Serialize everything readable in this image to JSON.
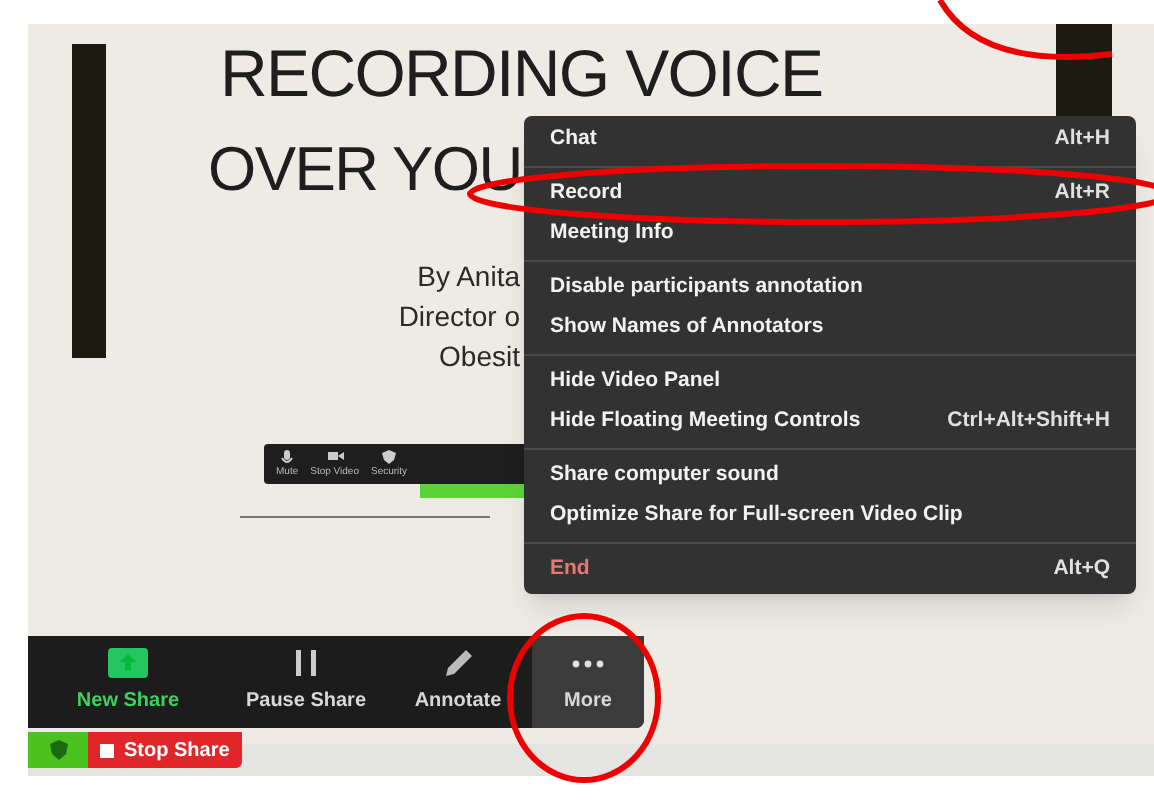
{
  "slide": {
    "title_lines": [
      "RECORDING VOICE",
      "OVER YOU"
    ],
    "byline_lines": [
      "By Anita",
      "Director o",
      "Obesit"
    ],
    "mini_toolbar": [
      {
        "label": "Mute",
        "kind": "mic"
      },
      {
        "label": "Stop Video",
        "kind": "camera"
      },
      {
        "label": "Security",
        "kind": "shield"
      }
    ]
  },
  "menu": {
    "sections": [
      [
        {
          "label": "Chat",
          "shortcut": "Alt+H",
          "kind": "normal"
        }
      ],
      [
        {
          "label": "Record",
          "shortcut": "Alt+R",
          "kind": "normal"
        },
        {
          "label": "Meeting Info",
          "kind": "normal"
        }
      ],
      [
        {
          "label": "Disable participants annotation",
          "kind": "normal"
        },
        {
          "label": "Show Names of Annotators",
          "kind": "normal"
        }
      ],
      [
        {
          "label": "Hide Video Panel",
          "kind": "normal"
        },
        {
          "label": "Hide Floating Meeting Controls",
          "shortcut": "Ctrl+Alt+Shift+H",
          "kind": "normal"
        }
      ],
      [
        {
          "label": "Share computer sound",
          "kind": "normal"
        },
        {
          "label": "Optimize Share for Full-screen Video Clip",
          "kind": "normal"
        }
      ],
      [
        {
          "label": "End",
          "shortcut": "Alt+Q",
          "kind": "danger"
        }
      ]
    ]
  },
  "toolbar": {
    "buttons": [
      {
        "label": "New Share",
        "kind": "new",
        "selected": false
      },
      {
        "label": "Pause Share",
        "kind": "pause",
        "selected": false
      },
      {
        "label": "Annotate",
        "kind": "pen",
        "selected": false
      },
      {
        "label": "More",
        "kind": "more",
        "selected": true
      }
    ]
  },
  "stop_share": {
    "label": "Stop Share"
  }
}
